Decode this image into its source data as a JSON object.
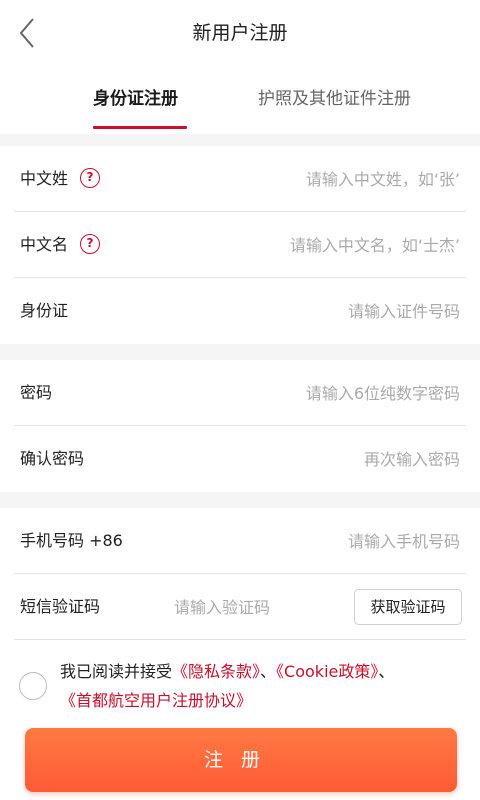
{
  "header": {
    "title": "新用户注册"
  },
  "tabs": [
    {
      "label": "身份证注册",
      "active": true
    },
    {
      "label": "护照及其他证件注册",
      "active": false
    }
  ],
  "form": {
    "surname": {
      "label": "中文姓",
      "placeholder": "请输入中文姓，如‘张’"
    },
    "given_name": {
      "label": "中文名",
      "placeholder": "请输入中文名，如‘士杰’"
    },
    "id_card": {
      "label": "身份证",
      "placeholder": "请输入证件号码"
    },
    "password": {
      "label": "密码",
      "placeholder": "请输入6位纯数字密码"
    },
    "confirm_password": {
      "label": "确认密码",
      "placeholder": "再次输入密码"
    },
    "phone": {
      "label": "手机号码 +86",
      "placeholder": "请输入手机号码"
    },
    "sms_code": {
      "label": "短信验证码",
      "placeholder": "请输入验证码",
      "button": "获取验证码"
    }
  },
  "agreement": {
    "prefix": "我已阅读并接受",
    "privacy": "《隐私条款》",
    "sep1": "、",
    "cookie": "《Cookie政策》",
    "sep2": "、",
    "terms": "《首都航空用户注册协议》"
  },
  "submit": {
    "label": "注册"
  },
  "colors": {
    "accent": "#c8102e",
    "button_gradient_top": "#ff7a42",
    "button_gradient_bottom": "#ff5a36",
    "gap": "#f5f5f5"
  }
}
